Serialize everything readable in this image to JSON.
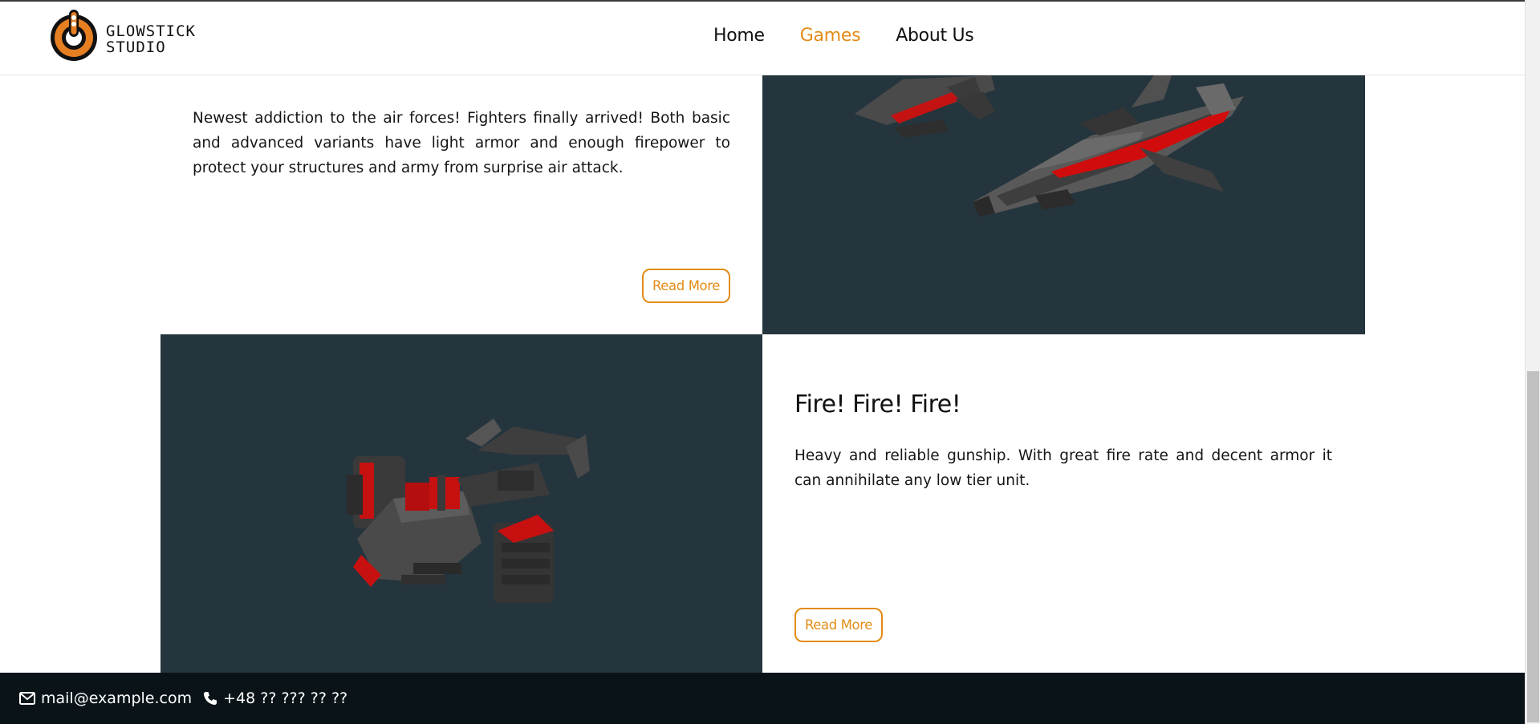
{
  "brand": {
    "logo_text_line1": "GLOWSTICK",
    "logo_text_line2": "STUDIO",
    "accent_color": "#e28c16",
    "image_bg_color": "#25353d"
  },
  "nav": {
    "items": [
      {
        "label": "Home",
        "active": false
      },
      {
        "label": "Games",
        "active": true
      },
      {
        "label": "About Us",
        "active": false
      }
    ]
  },
  "sections": [
    {
      "title": "",
      "description": "Newest addiction to the air forces! Fighters finally arrived! Both basic and advanced variants have light armor and enough firepower to protect your structures and army from surprise air attack.",
      "button_label": "Read More",
      "image_icon": "fighter-jets-image"
    },
    {
      "title": "Fire! Fire! Fire!",
      "description": "Heavy and reliable gunship. With great fire rate and decent armor it can annihilate any low tier unit.",
      "button_label": "Read More",
      "image_icon": "gunship-image"
    }
  ],
  "footer": {
    "email": "mail@example.com",
    "phone": "+48 ?? ??? ?? ??",
    "email_icon": "envelope-icon",
    "phone_icon": "phone-icon"
  }
}
